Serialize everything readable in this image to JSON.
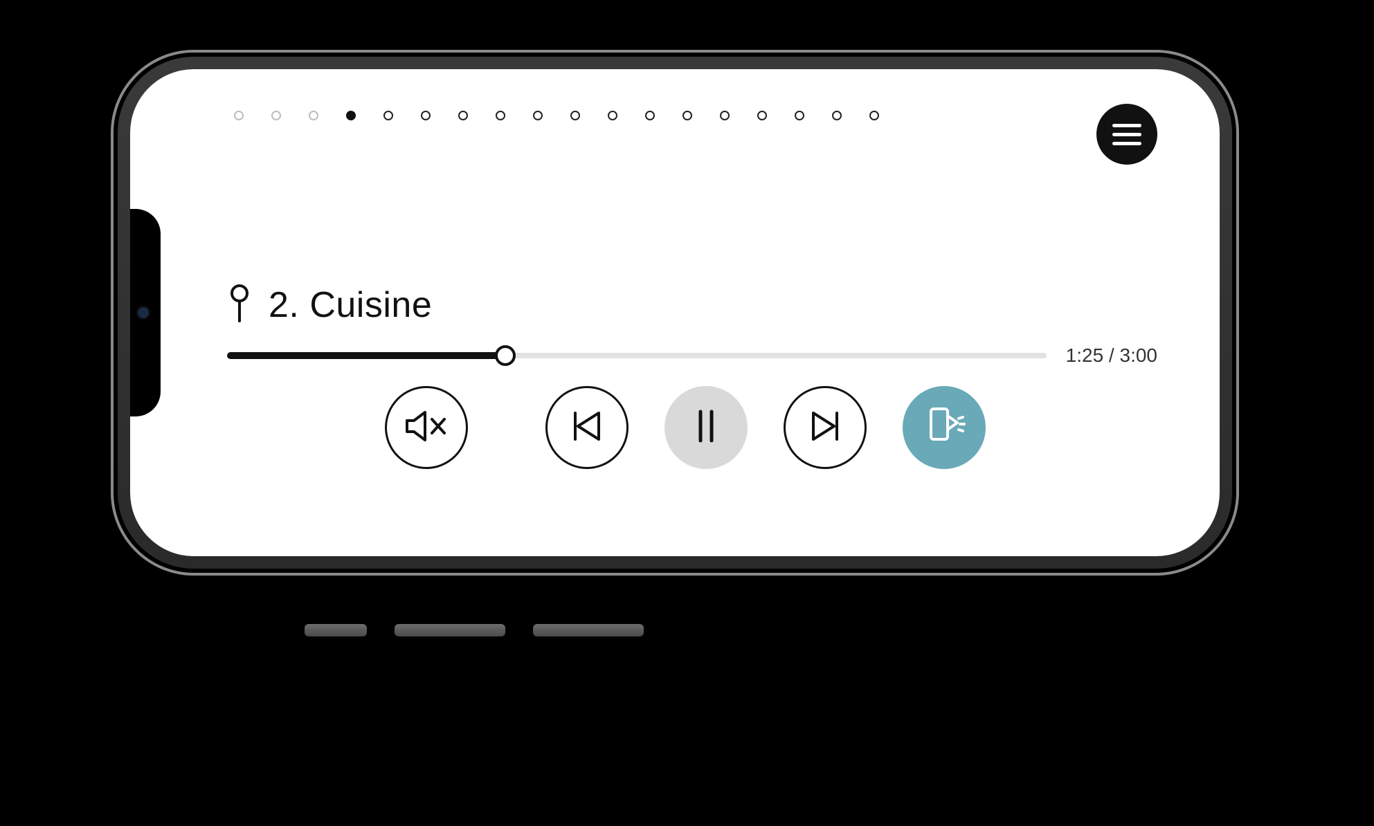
{
  "colors": {
    "accent": "#6aa9b8",
    "ink": "#111111"
  },
  "pagination": {
    "total": 18,
    "disabled": [
      0,
      1,
      2
    ],
    "current": 3
  },
  "track": {
    "title": "2. Cuisine"
  },
  "playback": {
    "position_label": "1:25",
    "duration_label": "3:00",
    "separator": " / ",
    "progress_percent": 34
  },
  "controls": {
    "mute": "mute",
    "prev": "previous",
    "playpause": "pause",
    "next": "next",
    "extra": "rotate-device"
  }
}
